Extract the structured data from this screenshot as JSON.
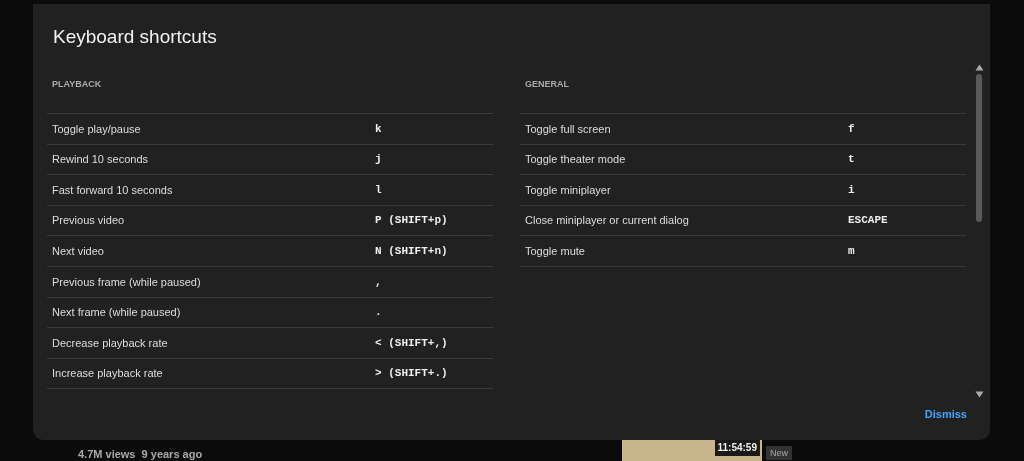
{
  "dialog": {
    "title": "Keyboard shortcuts",
    "sections": [
      {
        "heading": "PLAYBACK",
        "shortcuts": [
          {
            "action": "Toggle play/pause",
            "key": "k"
          },
          {
            "action": "Rewind 10 seconds",
            "key": "j"
          },
          {
            "action": "Fast forward 10 seconds",
            "key": "l"
          },
          {
            "action": "Previous video",
            "key": "P (SHIFT+p)"
          },
          {
            "action": "Next video",
            "key": "N (SHIFT+n)"
          },
          {
            "action": "Previous frame (while paused)",
            "key": ","
          },
          {
            "action": "Next frame (while paused)",
            "key": "."
          },
          {
            "action": "Decrease playback rate",
            "key": "< (SHIFT+,)"
          },
          {
            "action": "Increase playback rate",
            "key": "> (SHIFT+.)"
          }
        ]
      },
      {
        "heading": "GENERAL",
        "shortcuts": [
          {
            "action": "Toggle full screen",
            "key": "f"
          },
          {
            "action": "Toggle theater mode",
            "key": "t"
          },
          {
            "action": "Toggle miniplayer",
            "key": "i"
          },
          {
            "action": "Close miniplayer or current dialog",
            "key": "ESCAPE"
          },
          {
            "action": "Toggle mute",
            "key": "m"
          }
        ]
      }
    ],
    "dismiss": "Dismiss"
  },
  "background": {
    "video_meta": "4.7M views  9 years ago",
    "thumbnail_duration": "11:54:59",
    "badge": "New"
  }
}
